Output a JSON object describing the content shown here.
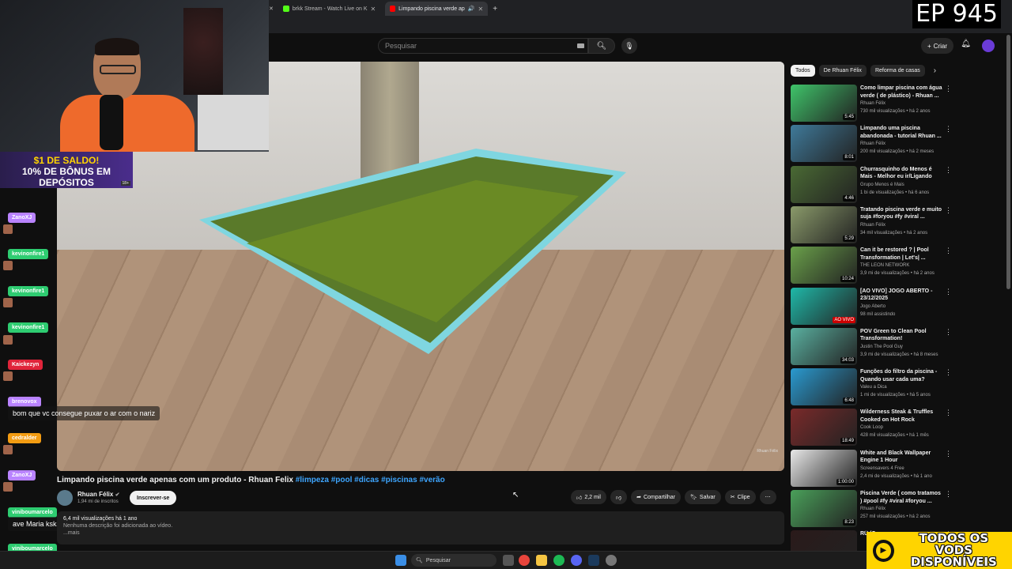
{
  "browser": {
    "tabs": [
      {
        "label": "brkk Stream - Watch Live on K",
        "active": false
      },
      {
        "label": "Limpando piscina verde ap",
        "active": true
      }
    ],
    "new_tab_symbol": "+"
  },
  "youtube_header": {
    "search_placeholder": "Pesquisar",
    "create_label": "Criar"
  },
  "episode_badge": "EP 945",
  "promo": {
    "line1": "$1 DE SALDO!",
    "line2": "10% DE BÔNUS EM DEPÓSITOS",
    "age": "18+"
  },
  "chat": {
    "messages": [
      {
        "user": "ZanoXJ",
        "color": "#b983ff",
        "text": ""
      },
      {
        "user": "kevinonfire1",
        "color": "#2ecc71",
        "text": ""
      },
      {
        "user": "kevinonfire1",
        "color": "#2ecc71",
        "text": ""
      },
      {
        "user": "kevinonfire1",
        "color": "#2ecc71",
        "text": ""
      },
      {
        "user": "Kaickezyn",
        "color": "#e0243a",
        "text": ""
      },
      {
        "user": "brenovox",
        "color": "#b983ff",
        "text": "bom que vc consegue puxar o ar com o nariz"
      },
      {
        "user": "cedralder",
        "color": "#f39c12",
        "text": ""
      },
      {
        "user": "ZanoXJ",
        "color": "#b983ff",
        "text": ""
      },
      {
        "user": "viniboumarcelo",
        "color": "#2ecc71",
        "text": "ave Maria ksksksksksk"
      },
      {
        "user": "viniboumarcelo",
        "color": "#2ecc71",
        "text": ""
      }
    ]
  },
  "chips": [
    "Todos",
    "De Rhuan Félix",
    "Reforma de casas"
  ],
  "recommendations": [
    {
      "title": "Como limpar piscina com água verde ( de plástico) - Rhuan ...",
      "channel": "Rhuan Félix",
      "meta": "730 mil visualizações • há 2 anos",
      "duration": "5:45",
      "thumb": "#3fc46a"
    },
    {
      "title": "Limpando uma piscina abandonada - tutorial Rhuan ...",
      "channel": "Rhuan Félix",
      "meta": "200 mil visualizações • há 2 meses",
      "duration": "8:01",
      "thumb": "#3f7a9a"
    },
    {
      "title": "Churrasquinho do Menos é Mais - Melhor eu ir/Ligando os...",
      "channel": "Grupo Menos é Mais",
      "meta": "1 bi de visualizações • há 6 anos",
      "duration": "4:46",
      "thumb": "#4a6a34"
    },
    {
      "title": "Tratando piscina verde e muito suja #foryou #fy #viral ...",
      "channel": "Rhuan Félix",
      "meta": "34 mil visualizações • há 2 anos",
      "duration": "5:29",
      "thumb": "#8a9a6a"
    },
    {
      "title": "Can it be restored ? | Pool Transformation | Let's| ...",
      "channel": "THE LEON NETWORK",
      "meta": "3,9 mi de visualizações • há 2 anos",
      "duration": "10:24",
      "thumb": "#6aa04a"
    },
    {
      "title": "[AO VIVO] JOGO ABERTO - 23/12/2025",
      "channel": "Jogo Aberto",
      "meta": "98 mil assistindo",
      "duration": "AO VIVO",
      "thumb": "#1fb8a8"
    },
    {
      "title": "POV Green to Clean Pool Transformation!",
      "channel": "Justin The Pool Guy",
      "meta": "3,9 mi de visualizações • há 8 meses",
      "duration": "34:03",
      "thumb": "#5ab0a0"
    },
    {
      "title": "Funções do filtro da piscina - Quando usar cada uma?",
      "channel": "Valeu a Dica",
      "meta": "1 mi de visualizações • há 5 anos",
      "duration": "6:48",
      "thumb": "#2a9ad0"
    },
    {
      "title": "Wilderness Steak & Truffles Cooked on Hot Rock",
      "channel": "Cook Loop",
      "meta": "428 mil visualizações • há 1 mês",
      "duration": "18:49",
      "thumb": "#7a2a2a"
    },
    {
      "title": "White and Black Wallpaper Engine 1 Hour",
      "channel": "Screensavers 4 Free",
      "meta": "2,4 mi de visualizações • há 1 ano",
      "duration": "1:00:00",
      "thumb": "#e8e8e8"
    },
    {
      "title": "Piscina Verde ( como tratamos ) #pool #fy #viral #foryou ...",
      "channel": "Rhuan Félix",
      "meta": "257 mil visualizações • há 2 anos",
      "duration": "8:23",
      "thumb": "#4aa05a"
    },
    {
      "title": "RÜ (C...",
      "channel": "",
      "meta": "",
      "duration": "",
      "thumb": "#2a1a1a"
    }
  ],
  "video": {
    "title": "Limpando piscina verde apenas com um produto - Rhuan Felix",
    "tags": "#limpeza #pool #dicas #piscinas #verão",
    "channel": "Rhuan Félix",
    "subs": "1,94 mi de inscritos",
    "subscribe": "Inscrever-se",
    "likes": "2,2 mil",
    "share": "Compartilhar",
    "save": "Salvar",
    "clip": "Clipe",
    "desc_views": "6,4 mil visualizações  há 1 ano",
    "desc_text": "Nenhuma descrição foi adicionada ao vídeo.",
    "desc_more": "...mais",
    "watermark": "Rhuan Félix"
  },
  "taskbar": {
    "search": "Pesquisar"
  },
  "vods_badge": {
    "line1": "TODOS OS VODS",
    "line2": "DISPONÍVEIS"
  }
}
